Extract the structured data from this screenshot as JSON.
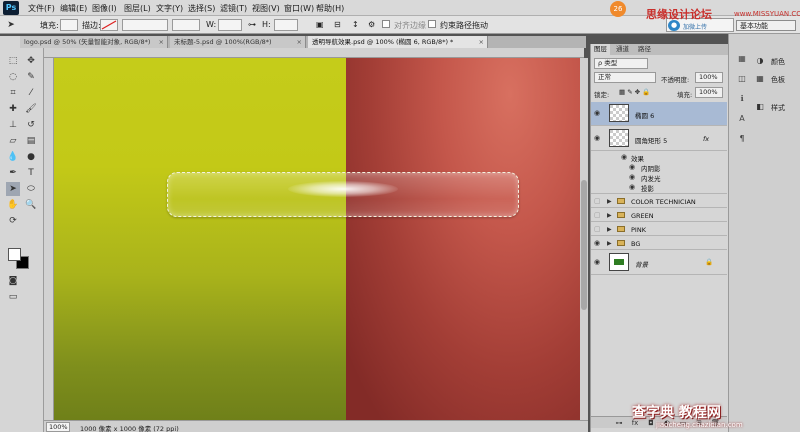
{
  "menubar": {
    "app_logo": "Ps",
    "items": [
      "文件(F)",
      "编辑(E)",
      "图像(I)",
      "图层(L)",
      "文字(Y)",
      "选择(S)",
      "滤镜(T)",
      "视图(V)",
      "窗口(W)",
      "帮助(H)"
    ]
  },
  "watermark_top": {
    "badge": "26",
    "site": "思缘设计论坛",
    "url": "www.MISSYUAN.COM",
    "chat_label": "加微上传"
  },
  "options_bar": {
    "fill_label": "填充:",
    "stroke_label": "描边:",
    "w_label": "W:",
    "h_label": "H:",
    "align_edges_label": "对齐边缘",
    "constrain_path_label": "约束路径拖动",
    "workspace": "基本功能"
  },
  "document_tabs": [
    {
      "label": "logo.psd @ 50% (矢量智能对象, RGB/8*)",
      "active": false
    },
    {
      "label": "未标题-5.psd @ 100%(RGB/8*)",
      "active": false
    },
    {
      "label": "透明导航效果.psd @ 100% (椭圆 6, RGB/8*) *",
      "active": true
    }
  ],
  "status_bar": {
    "zoom": "100%",
    "doc_info": "1000 像素 x 1000 像素 (72 ppi)"
  },
  "layers_panel": {
    "tabs": [
      "图层",
      "通道",
      "路径"
    ],
    "filter_kind": "ρ 类型",
    "blend_mode": "正常",
    "opacity_label": "不透明度:",
    "opacity_value": "100%",
    "lock_label": "锁定:",
    "fill_label": "填充:",
    "fill_value": "100%",
    "layers": [
      {
        "name": "椭圆 6",
        "type": "shape",
        "selected": true
      },
      {
        "name": "圆角矩形 5",
        "type": "shape",
        "fx": "fx"
      },
      {
        "name": "效果",
        "type": "effects"
      },
      {
        "name": "内阴影",
        "type": "effect"
      },
      {
        "name": "内发光",
        "type": "effect"
      },
      {
        "name": "投影",
        "type": "effect"
      },
      {
        "name": "COLOR TECHNICIAN",
        "type": "group"
      },
      {
        "name": "GREEN",
        "type": "group"
      },
      {
        "name": "PINK",
        "type": "group"
      },
      {
        "name": "BG",
        "type": "group"
      },
      {
        "name": "背景",
        "type": "background"
      }
    ]
  },
  "right_dock": {
    "items": [
      {
        "label": "颜色",
        "icon": "color-wheel-icon"
      },
      {
        "label": "色板",
        "icon": "swatches-icon"
      },
      {
        "label": "样式",
        "icon": "styles-icon"
      }
    ]
  },
  "watermark_bottom": {
    "main": "查字典 教程网",
    "url": "jiaocheng.chazidian.com"
  },
  "colors": {
    "canvas_green": "#c5cc1a",
    "canvas_red": "#c4574b",
    "selection_row": "#a8bad4",
    "layer_bg_thumb": "#2f7d22"
  }
}
